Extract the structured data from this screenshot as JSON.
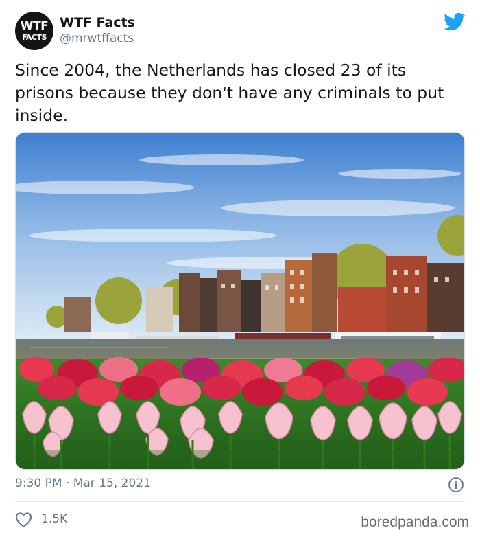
{
  "author": {
    "display_name": "WTF Facts",
    "handle": "@mrwtffacts",
    "avatar_line1": "WTF",
    "avatar_line2": "FACTS"
  },
  "tweet": {
    "text": "Since 2004, the Netherlands has closed 23 of its prisons because they don't have any criminals to put inside.",
    "timestamp": "9:30 PM · Mar 15, 2021",
    "like_count": "1.5K"
  },
  "icons": {
    "brand": "twitter-bird-icon",
    "info": "info-icon",
    "like": "heart-icon"
  },
  "colors": {
    "accent": "#1da1f2",
    "text": "#14171a",
    "secondary_text": "#657786"
  },
  "watermark": "boredpanda.com"
}
